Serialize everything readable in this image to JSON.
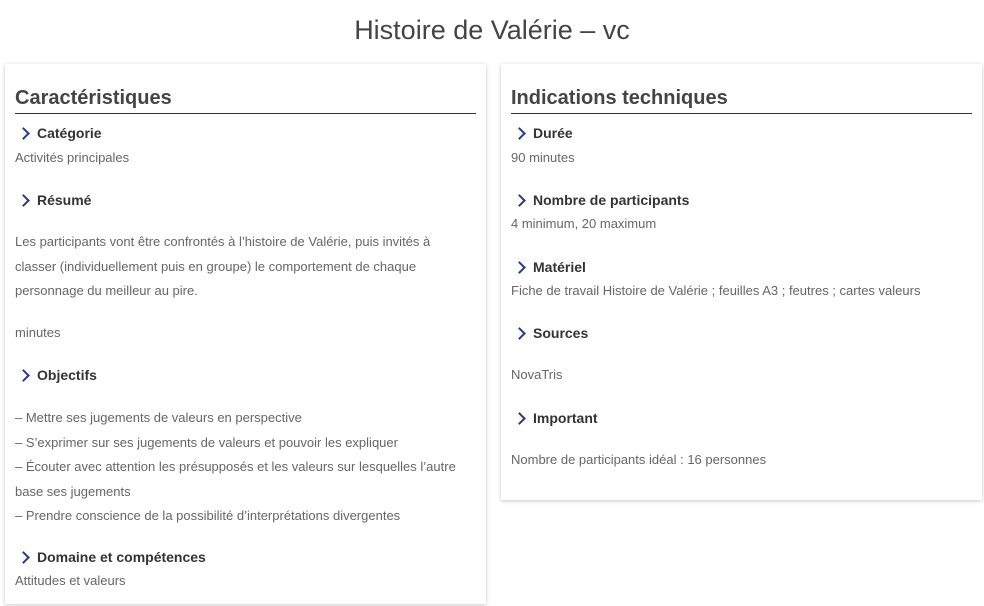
{
  "page": {
    "title": "Histoire de Valérie – vc"
  },
  "left": {
    "heading": "Caractéristiques",
    "categorie": {
      "title": "Catégorie",
      "text": "Activités principales"
    },
    "resume": {
      "title": "Résumé",
      "lines": [
        "Les participants vont être confrontés à l’histoire de Valérie, puis invités à",
        "classer (individuellement puis en groupe) le comportement de chaque",
        "personnage du meilleur au pire."
      ],
      "extra": "minutes"
    },
    "objectifs": {
      "title": "Objectifs",
      "lines": [
        "– Mettre ses jugements de valeurs en perspective",
        "– S’exprimer sur ses jugements de valeurs et pouvoir les expliquer",
        "– Écouter avec attention les présupposés et les valeurs sur lesquelles l’autre",
        "base ses jugements",
        "– Prendre conscience de la possibilité d’interprétations divergentes"
      ]
    },
    "domaine": {
      "title": "Domaine et compétences",
      "text": "Attitudes et valeurs"
    }
  },
  "right": {
    "heading": "Indications techniques",
    "duree": {
      "title": "Durée",
      "text": "90 minutes"
    },
    "participants": {
      "title": "Nombre de participants",
      "text": "4 minimum, 20 maximum"
    },
    "materiel": {
      "title": "Matériel",
      "text": "Fiche de travail Histoire de Valérie ; feuilles A3 ; feutres ; cartes valeurs"
    },
    "sources": {
      "title": "Sources",
      "text": "NovaTris"
    },
    "important": {
      "title": "Important",
      "text": "Nombre de participants idéal : 16 personnes"
    }
  },
  "icons": {
    "section": "chevron-right-icon"
  },
  "colors": {
    "chevron": "#2a3a7c",
    "heading_rule": "#333333"
  }
}
